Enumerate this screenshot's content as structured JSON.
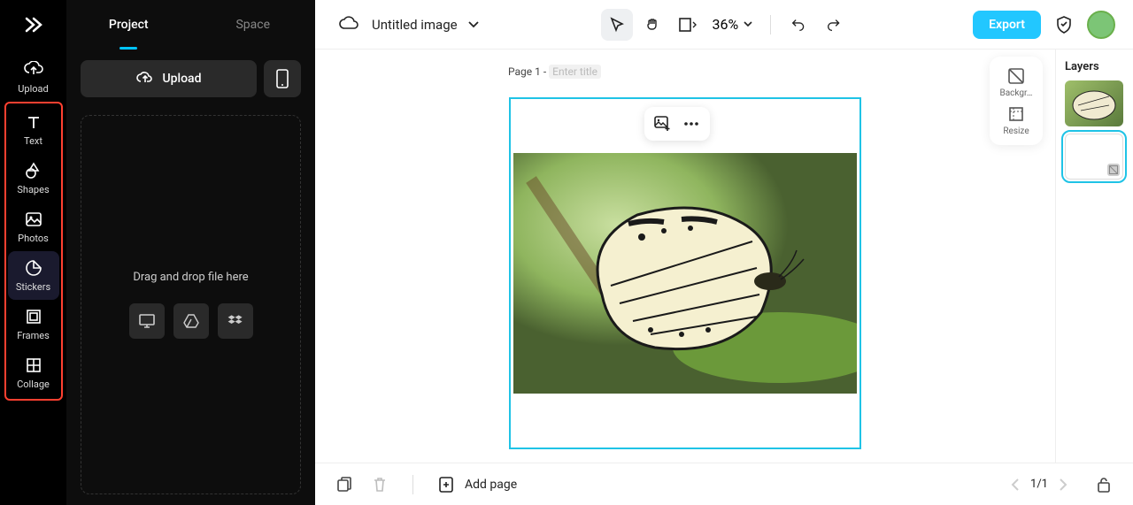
{
  "rail": {
    "items": [
      {
        "label": "Upload",
        "icon": "cloud-upload-icon"
      },
      {
        "label": "Text",
        "icon": "text-icon"
      },
      {
        "label": "Shapes",
        "icon": "shapes-icon"
      },
      {
        "label": "Photos",
        "icon": "photos-icon"
      },
      {
        "label": "Stickers",
        "icon": "stickers-icon"
      },
      {
        "label": "Frames",
        "icon": "frames-icon"
      },
      {
        "label": "Collage",
        "icon": "collage-icon"
      }
    ]
  },
  "side": {
    "tabs": {
      "project": "Project",
      "space": "Space"
    },
    "upload_label": "Upload",
    "drop_text": "Drag and drop file here"
  },
  "top": {
    "title": "Untitled image",
    "zoom": "36%",
    "export": "Export"
  },
  "canvas": {
    "page_prefix": "Page 1 - ",
    "title_placeholder": "Enter title",
    "side_actions": {
      "background": "Backgr…",
      "resize": "Resize"
    }
  },
  "layers": {
    "title": "Layers"
  },
  "bottom": {
    "add_page": "Add page",
    "page_of": "1/1"
  }
}
